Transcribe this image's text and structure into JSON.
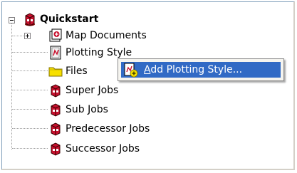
{
  "tree": {
    "root": {
      "label": "Quickstart",
      "icon": "quickstart-icon",
      "expanded": true
    },
    "children": [
      {
        "label": "Map Documents",
        "icon": "map-document-icon",
        "expandable": true
      },
      {
        "label": "Plotting Style",
        "icon": "plotting-style-icon",
        "expandable": false
      },
      {
        "label": "Files",
        "icon": "folder-icon",
        "expandable": false
      },
      {
        "label": "Super Jobs",
        "icon": "job-icon",
        "expandable": false
      },
      {
        "label": "Sub Jobs",
        "icon": "job-icon",
        "expandable": false
      },
      {
        "label": "Predecessor Jobs",
        "icon": "job-icon",
        "expandable": false
      },
      {
        "label": "Successor Jobs",
        "icon": "job-icon",
        "expandable": false
      }
    ]
  },
  "context_menu": {
    "items": [
      {
        "label_accel": "A",
        "label_rest": "dd Plotting Style...",
        "icon": "add-plotting-style-icon",
        "highlighted": true
      }
    ]
  },
  "colors": {
    "highlight": "#316ac5",
    "menu_bg": "#f5f4ef",
    "job_icon_red": "#c8102e",
    "folder_yellow": "#f7e000"
  }
}
